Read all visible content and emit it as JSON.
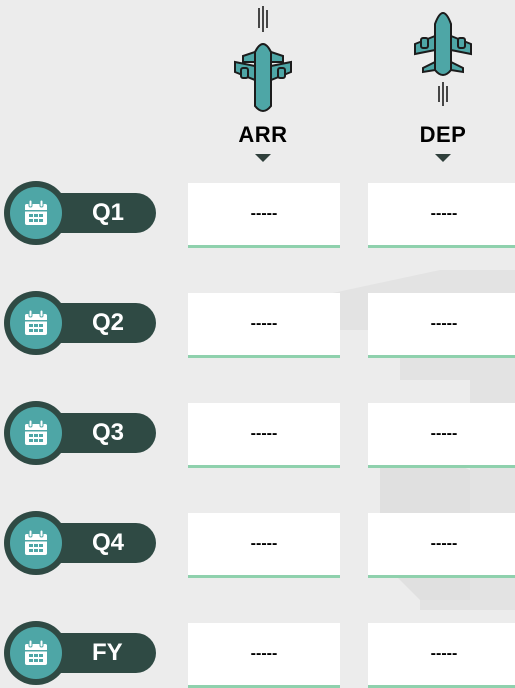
{
  "columns": [
    {
      "label": "ARR",
      "icon": "arrival-plane-icon"
    },
    {
      "label": "DEP",
      "icon": "departure-plane-icon"
    }
  ],
  "rows": [
    {
      "label": "Q1",
      "arr": "-----",
      "dep": "-----"
    },
    {
      "label": "Q2",
      "arr": "-----",
      "dep": "-----"
    },
    {
      "label": "Q3",
      "arr": "-----",
      "dep": "-----"
    },
    {
      "label": "Q4",
      "arr": "-----",
      "dep": "-----"
    },
    {
      "label": "FY",
      "arr": "-----",
      "dep": "-----"
    }
  ],
  "colors": {
    "background": "#ececec",
    "pill_dark": "#2f4a44",
    "pill_teal": "#4ea6a6",
    "underline": "#8fd1ad"
  }
}
